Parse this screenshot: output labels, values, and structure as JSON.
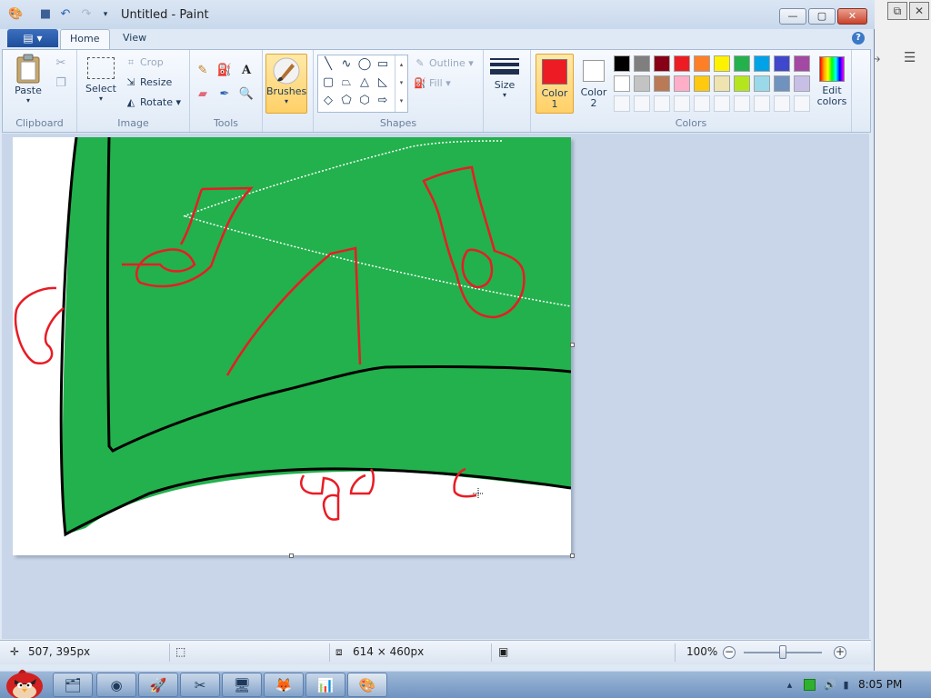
{
  "window": {
    "title": "Untitled - Paint"
  },
  "tabs": {
    "file_label": "",
    "home": "Home",
    "view": "View",
    "help": "?"
  },
  "ribbon": {
    "clipboard": {
      "group": "Clipboard",
      "paste": "Paste"
    },
    "image": {
      "group": "Image",
      "select": "Select",
      "crop": "Crop",
      "resize": "Resize",
      "rotate": "Rotate"
    },
    "tools": {
      "group": "Tools",
      "text_tool": "A"
    },
    "brushes": "Brushes",
    "shapes": {
      "group": "Shapes",
      "outline": "Outline",
      "fill": "Fill"
    },
    "size": "Size",
    "colors": {
      "group": "Colors",
      "color1": "Color 1",
      "color2": "Color 2",
      "edit": "Edit colors",
      "color1_value": "#ed1c24",
      "color2_value": "#ffffff",
      "palette_row1": [
        "#000000",
        "#7f7f7f",
        "#880015",
        "#ed1c24",
        "#ff7f27",
        "#fff200",
        "#22b14c",
        "#00a2e8",
        "#3f48cc",
        "#a349a4"
      ],
      "palette_row2": [
        "#ffffff",
        "#c3c3c3",
        "#b97a57",
        "#ffaec9",
        "#ffc90e",
        "#efe4b0",
        "#b5e61d",
        "#99d9ea",
        "#7092be",
        "#c8bfe7"
      ],
      "palette_row3": [
        "#f5f7fa",
        "#f5f7fa",
        "#f5f7fa",
        "#f5f7fa",
        "#f5f7fa",
        "#f5f7fa",
        "#f5f7fa",
        "#f5f7fa",
        "#f5f7fa",
        "#f5f7fa"
      ]
    }
  },
  "status": {
    "cursor_pos": "507, 395px",
    "canvas_size": "614 × 460px",
    "zoom": "100%"
  },
  "taskbar": {
    "clock": "8:05 PM",
    "apps": [
      "explorer-icon",
      "chrome-icon",
      "rocket-icon",
      "paint-tools-icon",
      "monitor-icon",
      "firefox-icon",
      "presentation-icon",
      "paint-icon"
    ]
  }
}
